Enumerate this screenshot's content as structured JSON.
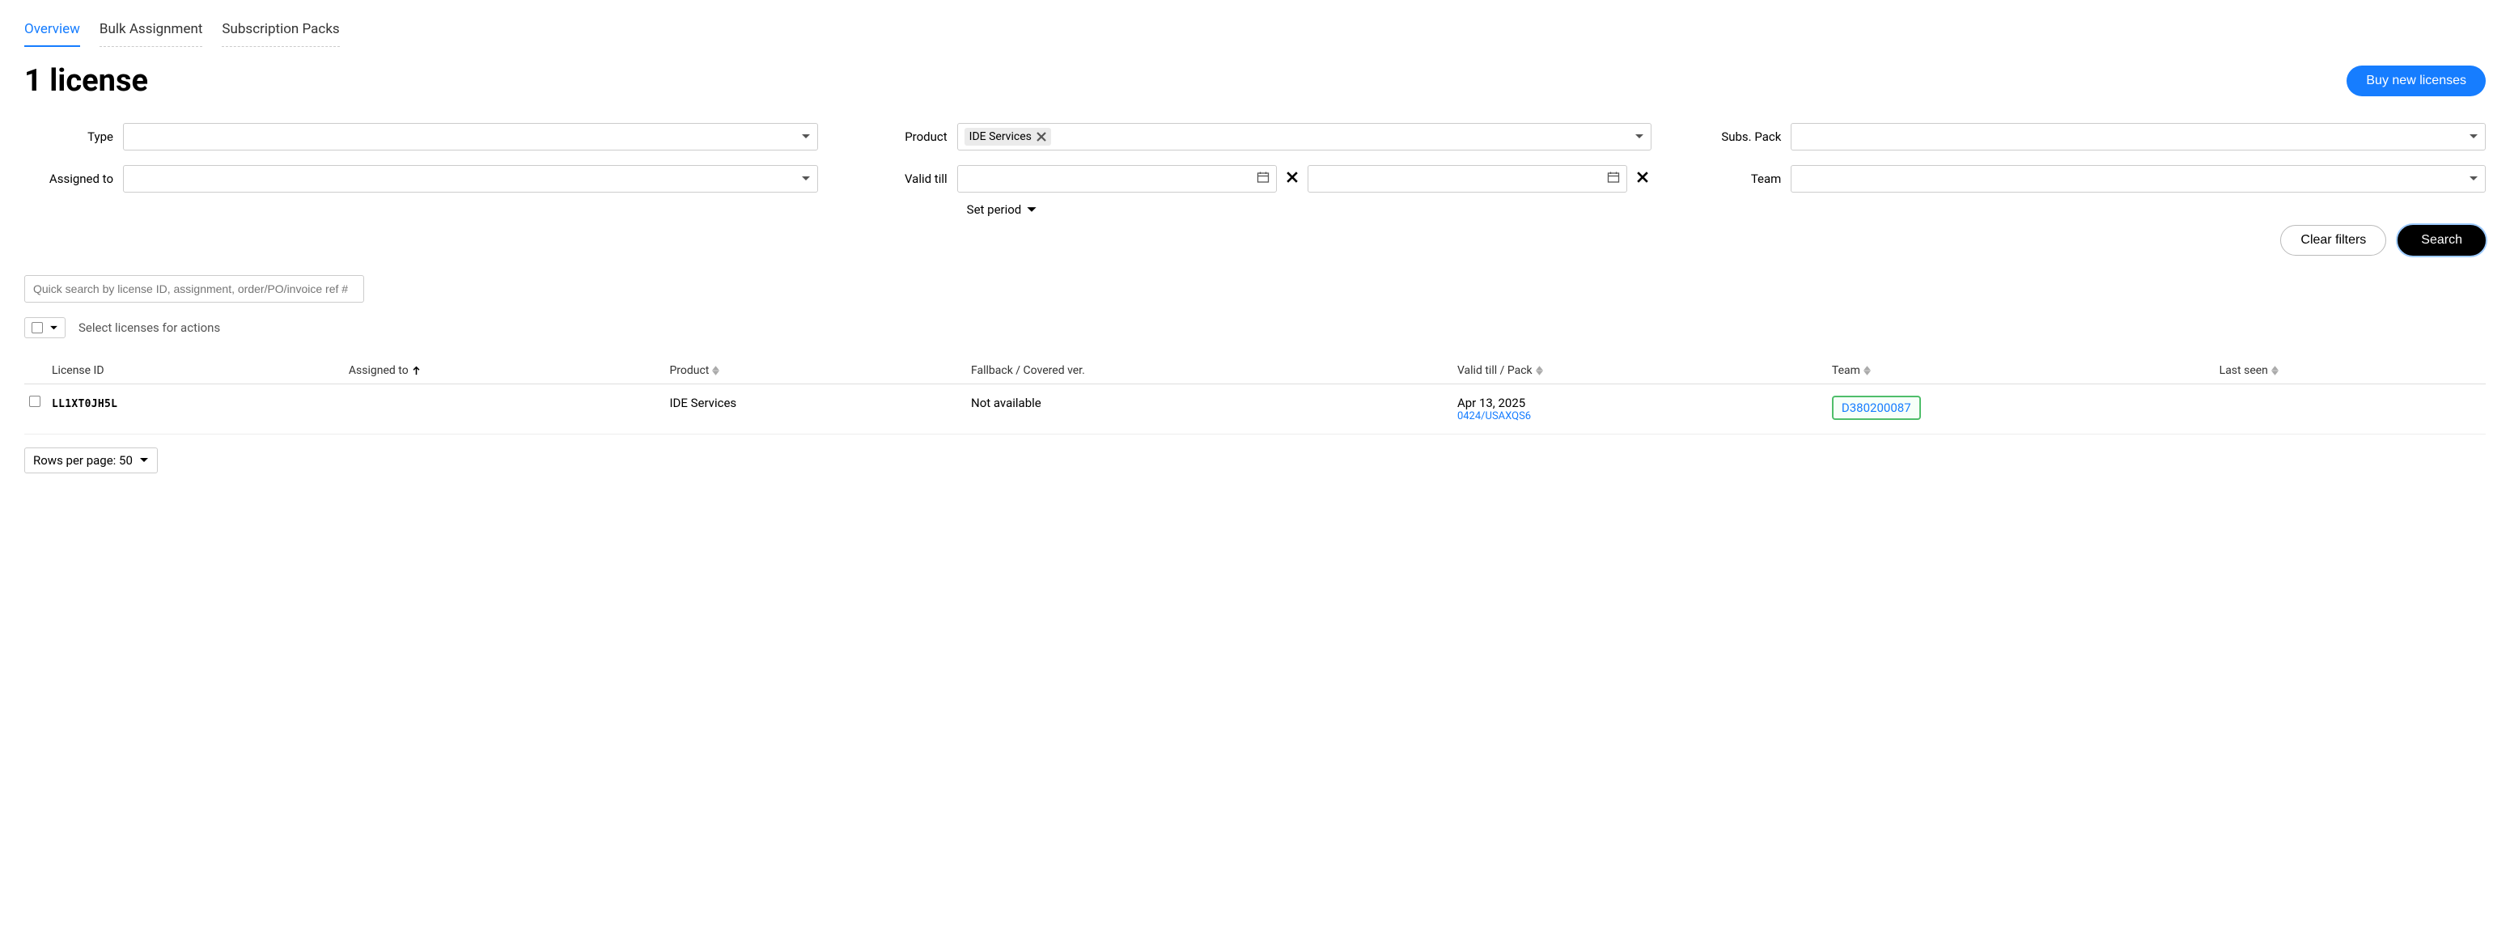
{
  "tabs": {
    "overview": "Overview",
    "bulk": "Bulk Assignment",
    "packs": "Subscription Packs"
  },
  "page_title": "1 license",
  "buy_button": "Buy new licenses",
  "filters": {
    "type_label": "Type",
    "product_label": "Product",
    "product_tag": "IDE Services",
    "subs_label": "Subs. Pack",
    "assigned_label": "Assigned to",
    "valid_label": "Valid till",
    "team_label": "Team",
    "set_period": "Set period"
  },
  "actions": {
    "clear": "Clear filters",
    "search": "Search"
  },
  "quick_search_placeholder": "Quick search by license ID, assignment, order/PO/invoice ref #",
  "bulk_hint": "Select licenses for actions",
  "table": {
    "headers": {
      "license_id": "License ID",
      "assigned_to": "Assigned to",
      "product": "Product",
      "fallback": "Fallback / Covered ver.",
      "valid": "Valid till / Pack",
      "team": "Team",
      "last_seen": "Last seen"
    },
    "row": {
      "license_id": "LL1XT0JH5L",
      "assigned_to": "",
      "product": "IDE Services",
      "fallback": "Not available",
      "valid_date": "Apr 13, 2025",
      "pack": "0424/USAXQS6",
      "team": "D380200087",
      "last_seen": ""
    }
  },
  "rows_per_page": "Rows per page: 50"
}
